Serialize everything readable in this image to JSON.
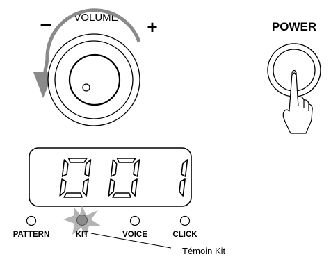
{
  "volume": {
    "label": "VOLUME",
    "minus": "−",
    "plus": "+"
  },
  "power": {
    "label": "POWER"
  },
  "display": {
    "digits": [
      "0",
      "0",
      "1"
    ]
  },
  "indicators": [
    {
      "label": "PATTERN",
      "lit": false
    },
    {
      "label": "KIT",
      "lit": true
    },
    {
      "label": "VOICE",
      "lit": false
    },
    {
      "label": "CLICK",
      "lit": false
    }
  ],
  "callout": {
    "text": "Témoin Kit"
  },
  "colors": {
    "ink": "#000000",
    "arrow": "#8a8a8a",
    "glow": "#b4b4b4",
    "led_lit": "#8c8c8c"
  }
}
